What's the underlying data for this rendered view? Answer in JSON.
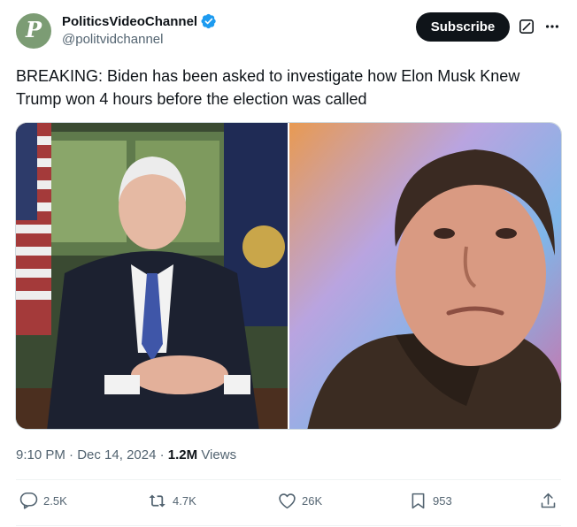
{
  "author": {
    "display_name": "PoliticsVideoChannel",
    "handle": "@politvidchannel",
    "avatar_letter": "P",
    "avatar_color": "#7c9c74",
    "verified_color": "#1d9bf0"
  },
  "header": {
    "subscribe_label": "Subscribe"
  },
  "tweet": {
    "text": "BREAKING: Biden has been asked to investigate how Elon Musk Knew Trump won 4 hours before the election was called"
  },
  "meta": {
    "time": "9:10 PM",
    "sep1": " · ",
    "date": "Dec 14, 2024",
    "sep2": " · ",
    "views_count": "1.2M",
    "views_label": " Views"
  },
  "actions": {
    "replies": "2.5K",
    "reposts": "4.7K",
    "likes": "26K",
    "bookmarks": "953"
  },
  "icons": [
    "verified-badge-icon",
    "grok-icon",
    "more-icon",
    "reply-icon",
    "repost-icon",
    "like-icon",
    "bookmark-icon",
    "share-icon"
  ]
}
